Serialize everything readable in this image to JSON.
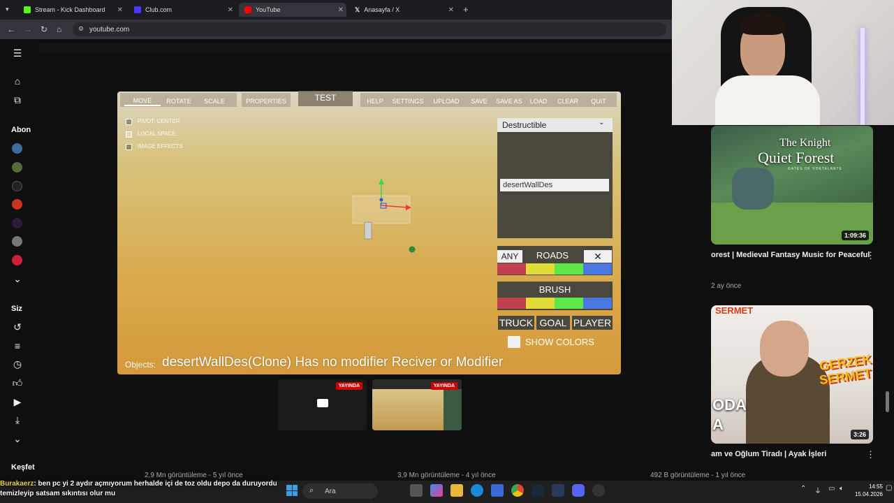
{
  "browser": {
    "tabs": [
      {
        "label": "Stream - Kick Dashboard",
        "color": "#53fc18"
      },
      {
        "label": "Club.com",
        "color": "#4a3aff"
      },
      {
        "label": "YouTube",
        "color": "#ff0000"
      },
      {
        "label": "Anasayfa / X",
        "color": "#ffffff"
      }
    ],
    "url": "youtube.com"
  },
  "sidebar": {
    "subscriptions_label": "Abon",
    "you_label": "Siz",
    "explore_label": "Keşfet"
  },
  "game": {
    "toolbar_left": [
      "MOVE",
      "ROTATE",
      "SCALE"
    ],
    "properties": "PROPERTIES",
    "test": "TEST",
    "toolbar_right": [
      "HELP",
      "SETTINGS",
      "UPLOAD",
      "SAVE",
      "SAVE AS",
      "LOAD",
      "CLEAR",
      "QUIT"
    ],
    "options": [
      "PIVOT: CENTER",
      "LOCAL SPACE",
      "IMAGE EFFECTS"
    ],
    "dropdown_selected": "Destructible",
    "object_name": "desertWallDes",
    "any_button": "ANY",
    "roads_label": "ROADS",
    "brush_label": "BRUSH",
    "swatch_colors": [
      "#c0404e",
      "#e2dc3a",
      "#5ee84a",
      "#4a78e0"
    ],
    "truck": "TRUCK",
    "goal": "GOAL",
    "player": "PLAYER",
    "show_colors": "SHOW COLORS",
    "objects_label": "Objects:",
    "message": "desertWallDes(Clone) Has no modifier Reciver or Modifier"
  },
  "previews": {
    "live_badge": "YAYINDA"
  },
  "videos": [
    {
      "thumb_title_1": "The Knight",
      "thumb_title_2": "Quiet Forest",
      "thumb_sub": "GATES OF VOKTALANTE",
      "duration": "1:09:36",
      "title": "orest | Medieval Fantasy Music for Peaceful",
      "meta": "2 ay önce"
    },
    {
      "thumb_badge_1": "GERZEK",
      "thumb_badge_2": "SERMET",
      "thumb_top": "SERMET",
      "thumb_overlay_1": "ODA",
      "thumb_overlay_2": "A",
      "duration": "3:26",
      "title": "am ve Oğlum Tiradı | Ayak İşleri",
      "meta": ""
    }
  ],
  "bottom_meta": [
    "2,9 Mn görüntüleme - 5 yıl önce",
    "3,9 Mn görüntüleme - 4 yıl önce",
    "492 B görüntüleme - 1 yıl önce"
  ],
  "chat": {
    "name": "Burakaerz",
    "line1": ": ben pc yi 2 aydır açmıyorum herhalde içi de toz oldu depo da duruyordu",
    "line2": "temizleyip satsam sıkıntısı olur mu"
  },
  "taskbar": {
    "search_label": "Ara",
    "time": "14:55",
    "date": "15.04.2026"
  }
}
